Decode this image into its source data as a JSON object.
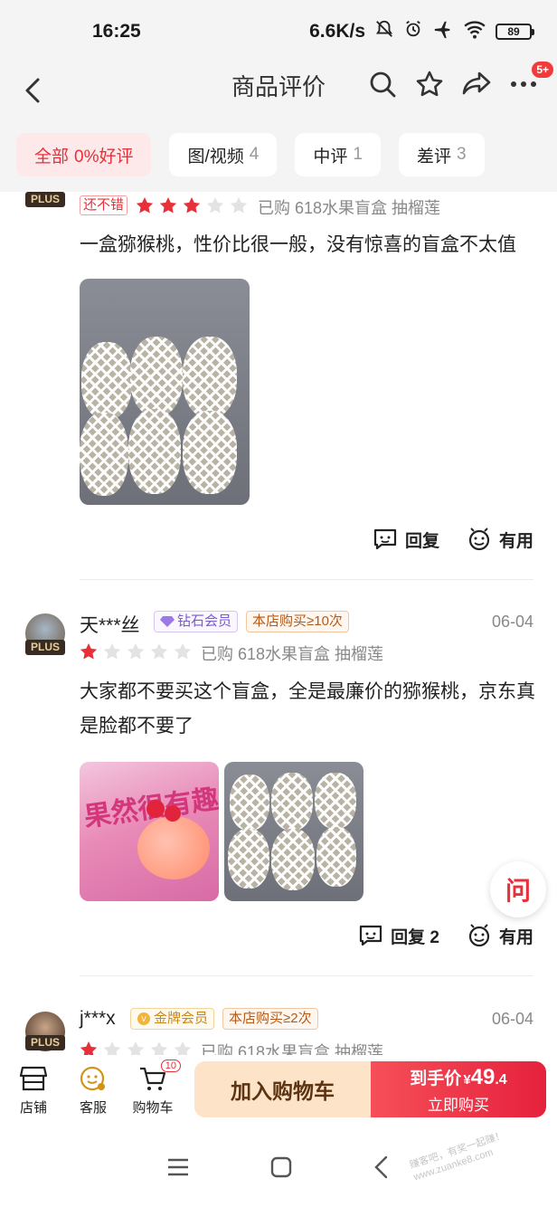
{
  "status_bar": {
    "time": "16:25",
    "net_speed": "6.6K/s",
    "battery": "89"
  },
  "nav": {
    "title": "商品评价",
    "message_badge": "5+"
  },
  "filters": [
    {
      "label": "全部",
      "extra": "0%好评",
      "active": true
    },
    {
      "label": "图/视频",
      "count": "4"
    },
    {
      "label": "中评",
      "count": "1"
    },
    {
      "label": "差评",
      "count": "3"
    }
  ],
  "reviews": [
    {
      "plus": "PLUS",
      "tag": "还不错",
      "rating": 3,
      "purchase": "已购 618水果盲盒 抽榴莲",
      "text": "一盒猕猴桃，性价比很一般，没有惊喜的盲盒不太值",
      "actions": {
        "reply": "回复",
        "useful": "有用"
      }
    },
    {
      "name": "天***丝",
      "plus": "PLUS",
      "member": "钻石会员",
      "buy_count": "本店购买≥10次",
      "date": "06-04",
      "rating": 1,
      "purchase": "已购 618水果盲盒 抽榴莲",
      "text": "大家都不要买这个盲盒，全是最廉价的猕猴桃，京东真是脸都不要了",
      "promo_text": "果然很有趣",
      "actions": {
        "reply": "回复 2",
        "useful": "有用"
      }
    },
    {
      "name": "j***x",
      "plus": "PLUS",
      "member": "金牌会员",
      "buy_count": "本店购买≥2次",
      "date": "06-04",
      "rating": 1,
      "purchase": "已购 618水果盲盒 抽榴莲"
    }
  ],
  "ask_button": "问",
  "bottom_bar": {
    "store": "店铺",
    "service": "客服",
    "cart": "购物车",
    "cart_count": "10",
    "add_to_cart": "加入购物车",
    "price_prefix": "到手价",
    "currency": "¥",
    "price_int": "49",
    "price_dec": ".4",
    "buy_now": "立即购买"
  },
  "watermark": "赚客吧，有奖一起赚！ www.zuanke8.com",
  "colors": {
    "accent_red": "#e8303b",
    "star_red": "#e8303b",
    "star_gray": "#e3e3e3"
  }
}
